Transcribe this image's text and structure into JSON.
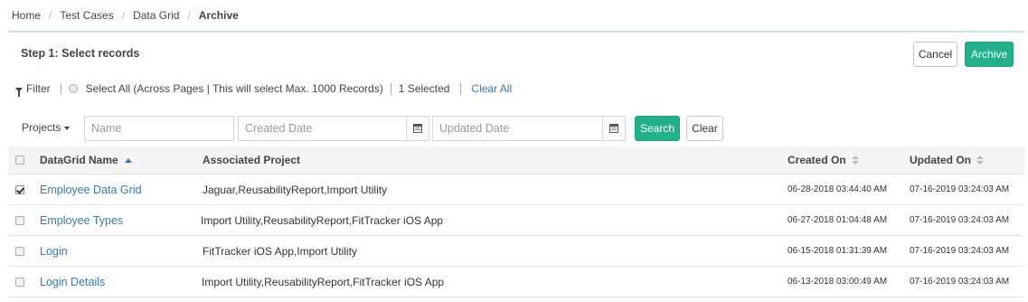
{
  "breadcrumb": {
    "home": "Home",
    "test_cases": "Test Cases",
    "data_grid": "Data Grid",
    "current": "Archive",
    "separator": "/"
  },
  "step": {
    "title": "Step 1: Select records"
  },
  "actions": {
    "cancel": "Cancel",
    "archive": "Archive"
  },
  "filter_bar": {
    "filter": "Filter",
    "select_all": "Select All (Across Pages | This will select Max. 1000 Records)",
    "selected": "1 Selected",
    "clear_all": "Clear All"
  },
  "search": {
    "projects": "Projects",
    "name_placeholder": "Name",
    "created_placeholder": "Created Date",
    "updated_placeholder": "Updated Date",
    "search_button": "Search",
    "clear_button": "Clear"
  },
  "grid": {
    "columns": {
      "name": "DataGrid Name",
      "project": "Associated Project",
      "created": "Created On",
      "updated": "Updated On"
    },
    "rows": [
      {
        "checked": true,
        "name": "Employee Data Grid",
        "project": "Jaguar,ReusabilityReport,Import Utility",
        "created": "06-28-2018 03:44:40 AM",
        "updated": "07-16-2019 03:24:03 AM"
      },
      {
        "checked": false,
        "name": "Employee Types",
        "project": "Import Utility,ReusabilityReport,FitTracker iOS App",
        "created": "06-27-2018 01:04:48 AM",
        "updated": "07-16-2019 03:24:03 AM"
      },
      {
        "checked": false,
        "name": "Login",
        "project": "FitTracker iOS App,Import Utility",
        "created": "06-15-2018 01:31:39 AM",
        "updated": "07-16-2019 03:24:03 AM"
      },
      {
        "checked": false,
        "name": "Login Details",
        "project": "Import Utility,ReusabilityReport,FitTracker iOS App",
        "created": "06-13-2018 03:00:49 AM",
        "updated": "07-16-2019 03:24:03 AM"
      }
    ]
  },
  "colors": {
    "primary": "#22b18a",
    "link": "#337ab7"
  }
}
